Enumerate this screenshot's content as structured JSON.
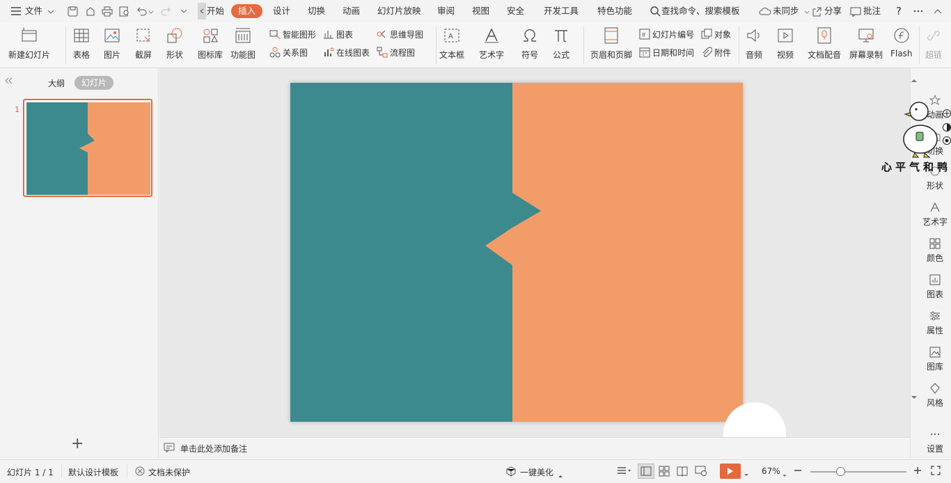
{
  "menubar": {
    "file_label": "文件",
    "tabs": [
      "开始",
      "插入",
      "设计",
      "切换",
      "动画",
      "幻灯片放映",
      "审阅",
      "视图",
      "安全",
      "开发工具",
      "特色功能"
    ],
    "active_tab": "插入",
    "search_label": "查找命令、搜索模板",
    "sync_label": "未同步",
    "share_label": "分享",
    "comment_label": "批注",
    "help_label": "?"
  },
  "ribbon": {
    "new_slide": "新建幻灯片",
    "table": "表格",
    "picture": "图片",
    "screenshot": "截屏",
    "shape": "形状",
    "icon_lib": "图标库",
    "function_chart": "功能图",
    "smart_art": "智能图形",
    "chart": "图表",
    "relation": "关系图",
    "online_chart": "在线图表",
    "mindmap": "思维导图",
    "flowchart": "流程图",
    "textbox": "文本框",
    "wordart": "艺术字",
    "symbol": "符号",
    "formula": "公式",
    "header_footer": "页眉和页脚",
    "slide_number": "幻灯片编号",
    "object": "对象",
    "datetime": "日期和时间",
    "attachment": "附件",
    "audio": "音频",
    "video": "视频",
    "doc_voice": "文档配音",
    "screen_record": "屏幕录制",
    "flash": "Flash",
    "hyperlink": "超链"
  },
  "leftpanel": {
    "outline_tab": "大纲",
    "slides_tab": "幻灯片",
    "slide_number": "1",
    "add_label": "+"
  },
  "notes": {
    "placeholder": "单击此处添加备注"
  },
  "rightbar": {
    "items": [
      "动画",
      "切换",
      "形状",
      "艺术字",
      "颜色",
      "图表",
      "属性",
      "图库",
      "风格",
      "设置"
    ]
  },
  "sticker": {
    "text": "心平气和鸭"
  },
  "statusbar": {
    "slide_info": "幻灯片 1 / 1",
    "template": "默认设计模板",
    "protect": "文档未保护",
    "beautify": "一键美化",
    "zoom": "67%"
  },
  "colors": {
    "teal": "#3c8a8e",
    "orange": "#f29c69",
    "accent": "#e5693f"
  }
}
